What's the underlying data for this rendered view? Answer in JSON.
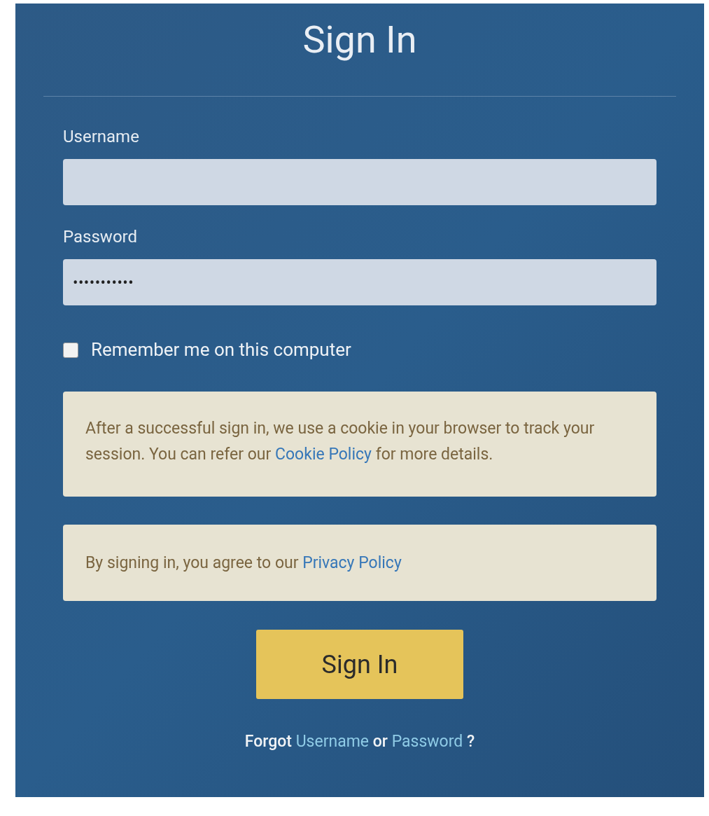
{
  "title": "Sign In",
  "fields": [
    {
      "label": "Username",
      "kind": "text"
    },
    {
      "label": "Password",
      "kind": "password",
      "value": "•••••••••••"
    }
  ],
  "remember": {
    "label": "Remember me on this computer",
    "checked": false
  },
  "notices": [
    {
      "before": "After a successful sign in, we use a cookie in your browser to track your session. You can refer our",
      "link": "Cookie Policy",
      "after": "for more details."
    },
    {
      "before": "By signing in, you agree to our",
      "link": "Privacy Policy"
    }
  ],
  "submit": "Sign In",
  "forgot": {
    "before": "Forgot",
    "link1": "Username",
    "middle": "or",
    "link2": "Password",
    "after": "?"
  }
}
